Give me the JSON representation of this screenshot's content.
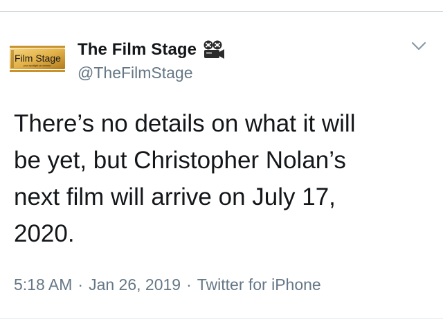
{
  "tweet": {
    "author": {
      "display_name": "The Film Stage",
      "handle": "@TheFilmStage",
      "avatar_text": "Film Stage",
      "avatar_tagline": "your spotlight on cinema",
      "avatar_icon": "film-stage-logo",
      "badge_icon": "film-camera-icon"
    },
    "menu_icon": "chevron-down-icon",
    "text": "There’s no details on what it will\nbe yet, but Christopher Nolan’s\nnext film will arrive on July 17,\n2020.",
    "time": "5:18 AM",
    "date": "Jan 26, 2019",
    "source": "Twitter for iPhone",
    "separator": "·"
  },
  "colors": {
    "text_primary": "#14171a",
    "text_secondary": "#657786",
    "divider": "#cfd6dc",
    "avatar_gold": "#e3b24a",
    "avatar_dark_gold": "#b07a1c"
  }
}
